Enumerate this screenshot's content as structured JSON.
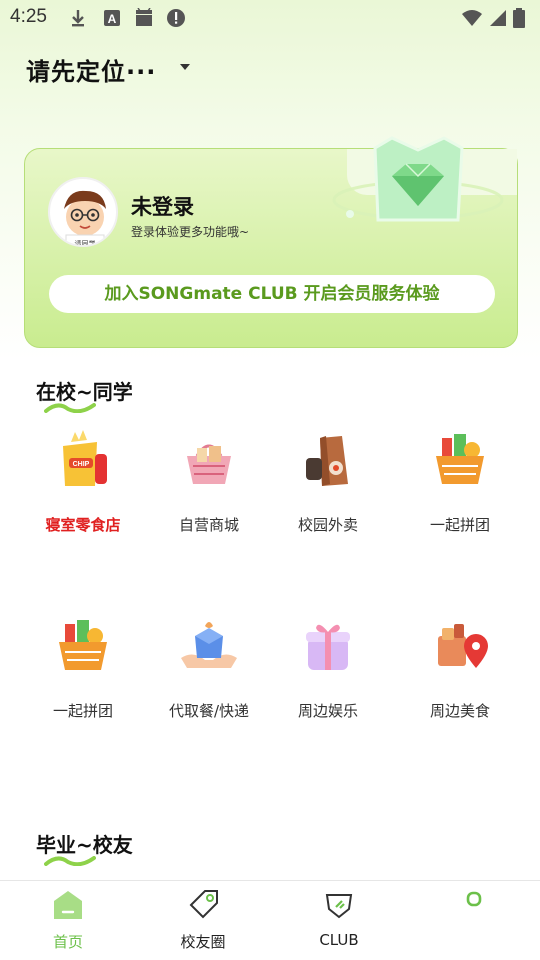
{
  "status_bar": {
    "time": "4:25",
    "left_icons": [
      "download-icon",
      "a-box-icon",
      "android-icon",
      "alert-icon"
    ],
    "right_icons": [
      "wifi-icon",
      "signal-icon",
      "battery-icon"
    ]
  },
  "location": {
    "label": "请先定位···"
  },
  "member_card": {
    "user_name": "未登录",
    "subtitle": "登录体验更多功能哦~",
    "avatar_caption": "请同学",
    "join_button": "加入SONGmate CLUB 开启会员服务体验"
  },
  "sections": [
    {
      "title": "在校~同学",
      "items": [
        {
          "label": "寝室零食店",
          "icon": "snack-icon",
          "highlight": true
        },
        {
          "label": "自营商城",
          "icon": "basket-icon",
          "highlight": false
        },
        {
          "label": "校园外卖",
          "icon": "takeout-icon",
          "highlight": false
        },
        {
          "label": "一起拼团",
          "icon": "grocery-basket-icon",
          "highlight": false
        },
        {
          "label": "一起拼团",
          "icon": "grocery-basket-icon",
          "highlight": false
        },
        {
          "label": "代取餐/快递",
          "icon": "parcel-icon",
          "highlight": false
        },
        {
          "label": "周边娱乐",
          "icon": "gift-icon",
          "highlight": false
        },
        {
          "label": "周边美食",
          "icon": "food-location-icon",
          "highlight": false
        }
      ]
    },
    {
      "title": "毕业~校友"
    }
  ],
  "bottom_nav": [
    {
      "label": "首页",
      "icon": "home-icon",
      "active": true
    },
    {
      "label": "校友圈",
      "icon": "tag-icon",
      "active": false
    },
    {
      "label": "CLUB",
      "icon": "club-icon",
      "active": false
    },
    {
      "label": "",
      "icon": "profile-icon",
      "active": false
    }
  ],
  "colors": {
    "accent_green": "#6cc04a",
    "card_green": "#c9ec8f",
    "join_text": "#5a9a1e",
    "highlight_red": "#e02020"
  }
}
